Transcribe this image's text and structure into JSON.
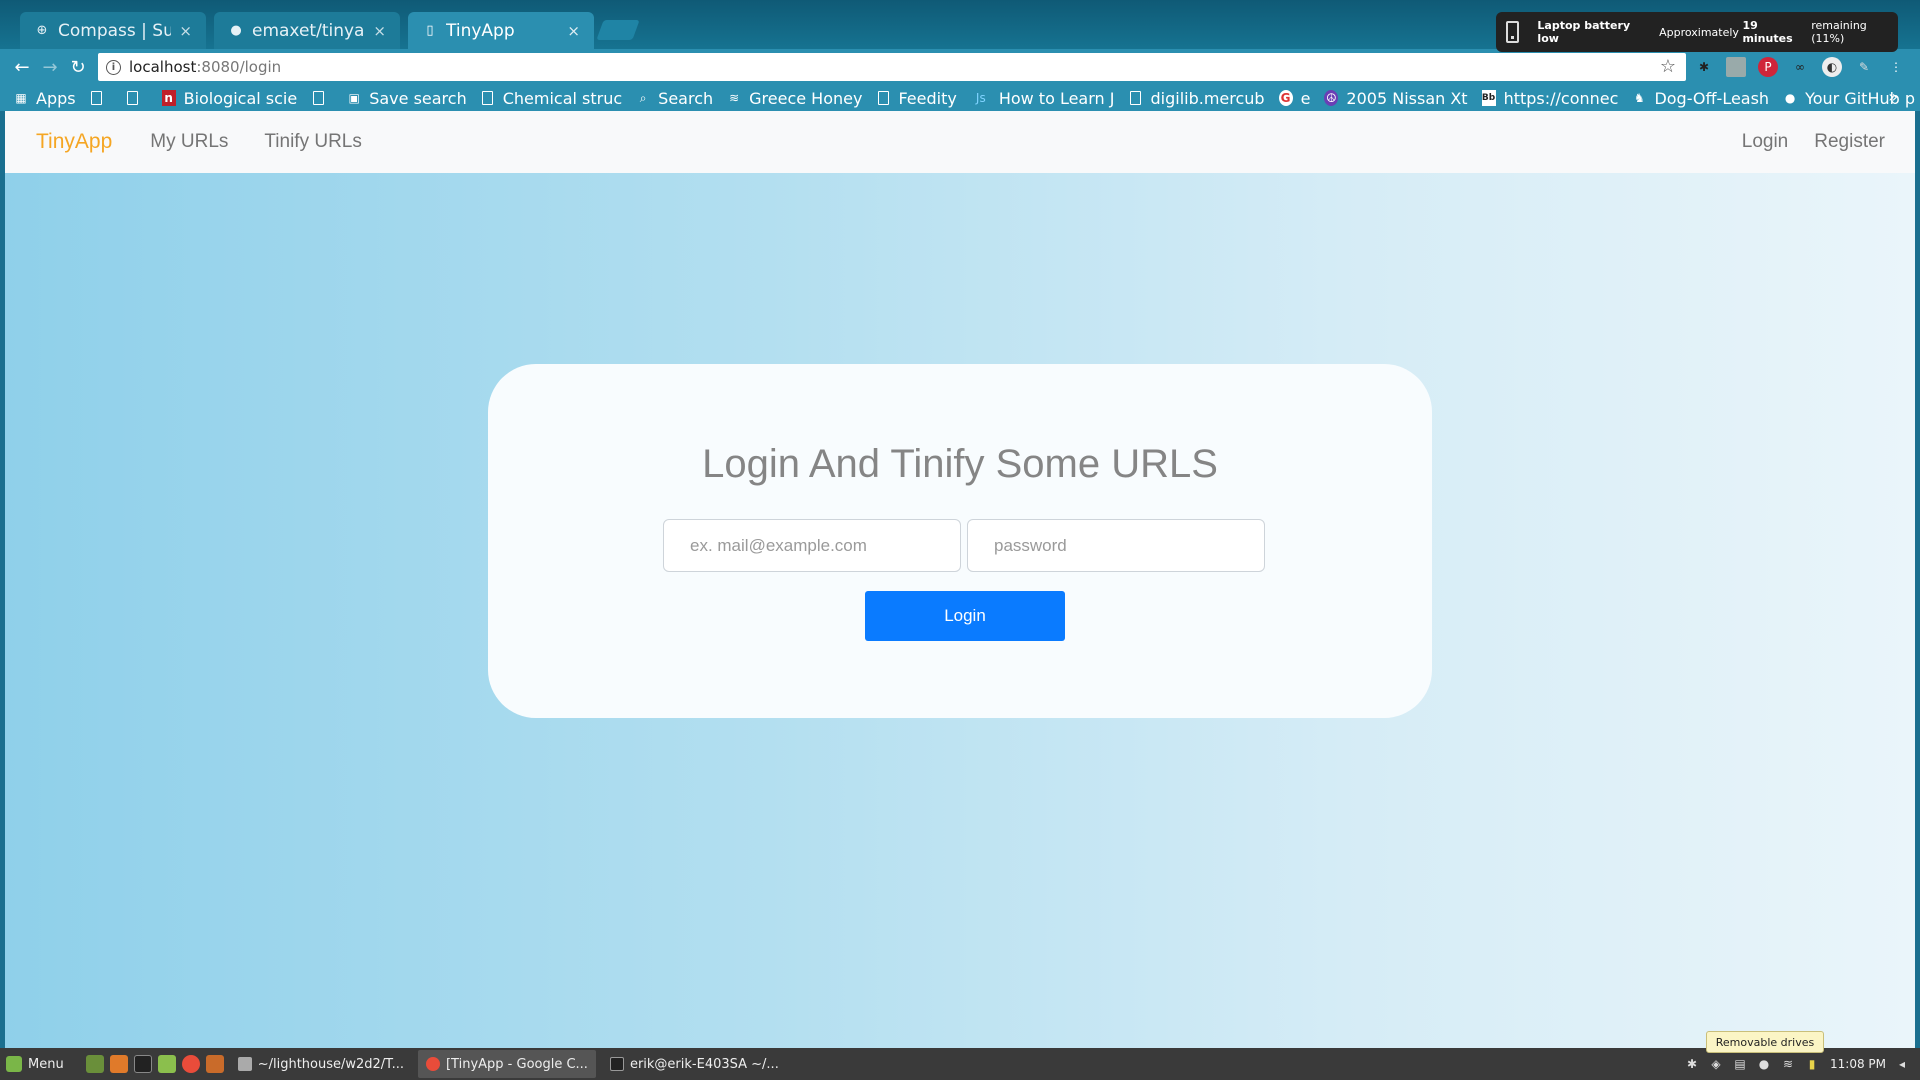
{
  "browser": {
    "tabs": [
      {
        "title": "Compass | Subm",
        "icon": "compass-icon",
        "active": false
      },
      {
        "title": "emaxet/tinyapp_",
        "icon": "github-icon",
        "active": false
      },
      {
        "title": "TinyApp",
        "icon": "page-icon",
        "active": true
      }
    ],
    "url_host": "localhost",
    "url_path": ":8080/login",
    "bookmarks": [
      {
        "label": "Apps",
        "icon": "apps-grid-icon"
      },
      {
        "label": "",
        "icon": "page-icon"
      },
      {
        "label": "",
        "icon": "page-icon"
      },
      {
        "label": "Biological scie",
        "icon": "n-logo-icon"
      },
      {
        "label": "",
        "icon": "page-icon"
      },
      {
        "label": "Save search",
        "icon": "save-search-icon"
      },
      {
        "label": "Chemical struc",
        "icon": "page-icon"
      },
      {
        "label": "Search",
        "icon": "search-icon"
      },
      {
        "label": "Greece Honey",
        "icon": "feather-icon"
      },
      {
        "label": "Feedity",
        "icon": "page-icon"
      },
      {
        "label": "How to Learn J",
        "icon": "js-icon"
      },
      {
        "label": "digilib.mercub",
        "icon": "page-icon"
      },
      {
        "label": "e",
        "icon": "google-icon"
      },
      {
        "label": "2005 Nissan Xt",
        "icon": "peace-icon"
      },
      {
        "label": "https://connec",
        "icon": "bb-icon"
      },
      {
        "label": "Dog-Off-Leash",
        "icon": "dog-icon"
      },
      {
        "label": "Your GitHub p",
        "icon": "github-icon"
      }
    ],
    "more_bookmarks": "»"
  },
  "notification": {
    "title": "Laptop battery low",
    "text_prefix": "Approximately",
    "text_bold": "19 minutes",
    "text_suffix": "remaining (11%)"
  },
  "app": {
    "brand": "TinyApp",
    "nav_left": [
      "My URLs",
      "Tinify URLs"
    ],
    "nav_right": [
      "Login",
      "Register"
    ],
    "heading": "Login And Tinify Some URLS",
    "email_placeholder": "ex. mail@example.com",
    "password_placeholder": "password",
    "submit_label": "Login"
  },
  "taskbar": {
    "menu_label": "Menu",
    "tasks": [
      {
        "label": "~/lighthouse/w2d2/T...",
        "active": false
      },
      {
        "label": "[TinyApp - Google C...",
        "active": true
      },
      {
        "label": "erik@erik-E403SA ~/...",
        "active": false
      }
    ],
    "clock": "11:08 PM",
    "tooltip": "Removable drives"
  },
  "colors": {
    "brand": "#f5a623",
    "primary_button": "#0a7bff",
    "browser_chrome": "#2b8fb0"
  }
}
